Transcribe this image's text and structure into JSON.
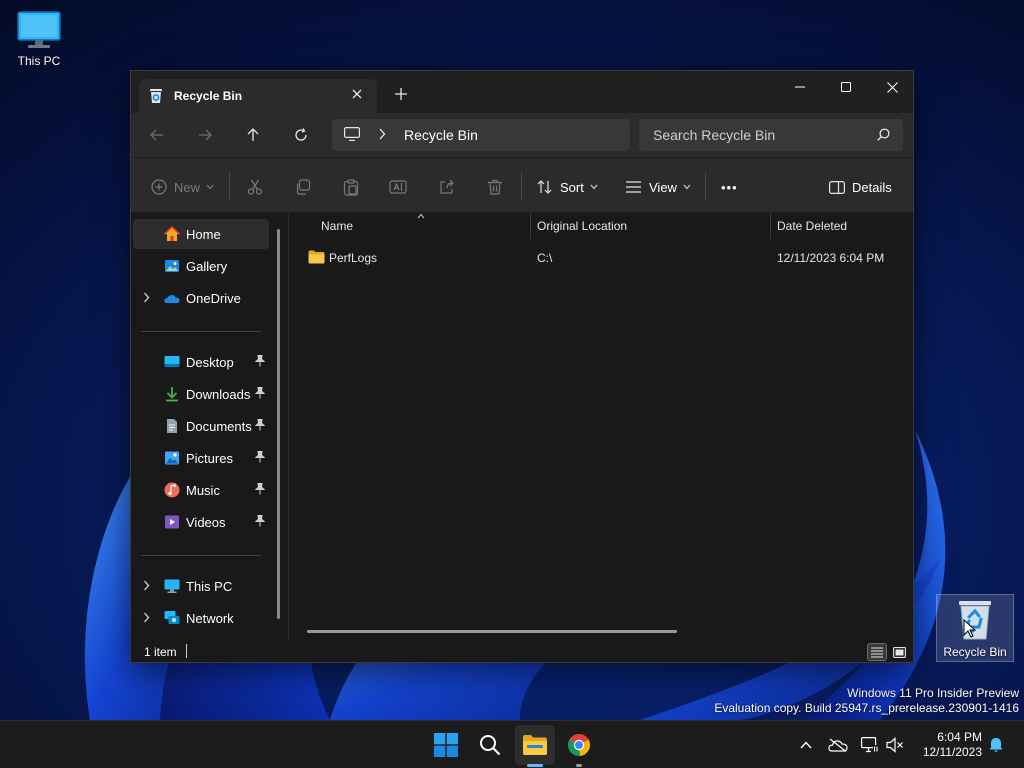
{
  "desktop": {
    "icons": [
      {
        "label": "This PC"
      },
      {
        "label": "Recycle Bin"
      }
    ],
    "watermark": {
      "line1": "Windows 11 Pro Insider Preview",
      "line2": "Evaluation copy. Build 25947.rs_prerelease.230901-1416"
    }
  },
  "window": {
    "tab_title": "Recycle Bin",
    "controls": {
      "minimize": "minimize",
      "maximize": "maximize",
      "close": "close"
    }
  },
  "navbar": {
    "breadcrumb": "Recycle Bin",
    "search_placeholder": "Search Recycle Bin"
  },
  "commandbar": {
    "new_label": "New",
    "sort_label": "Sort",
    "view_label": "View",
    "more_label": "•••",
    "details_label": "Details"
  },
  "sidebar": {
    "items": [
      {
        "label": "Home",
        "icon": "home-icon"
      },
      {
        "label": "Gallery",
        "icon": "gallery-icon"
      },
      {
        "label": "OneDrive",
        "icon": "onedrive-icon"
      },
      {
        "label": "Desktop",
        "icon": "desktop-icon"
      },
      {
        "label": "Downloads",
        "icon": "downloads-icon"
      },
      {
        "label": "Documents",
        "icon": "documents-icon"
      },
      {
        "label": "Pictures",
        "icon": "pictures-icon"
      },
      {
        "label": "Music",
        "icon": "music-icon"
      },
      {
        "label": "Videos",
        "icon": "videos-icon"
      },
      {
        "label": "This PC",
        "icon": "computer-icon"
      },
      {
        "label": "Network",
        "icon": "network-icon"
      }
    ]
  },
  "content": {
    "columns": [
      "Name",
      "Original Location",
      "Date Deleted"
    ],
    "rows": [
      {
        "name": "PerfLogs",
        "original_location": "C:\\",
        "date_deleted": "12/11/2023 6:04 PM"
      }
    ]
  },
  "status": {
    "item_count": "1 item"
  },
  "taskbar": {
    "time": "6:04 PM",
    "date": "12/11/2023"
  },
  "colors": {
    "accent": "#0078d4",
    "window_bg": "#191919",
    "bar_bg": "#2b2b2b",
    "folder": "#f5c33b"
  }
}
